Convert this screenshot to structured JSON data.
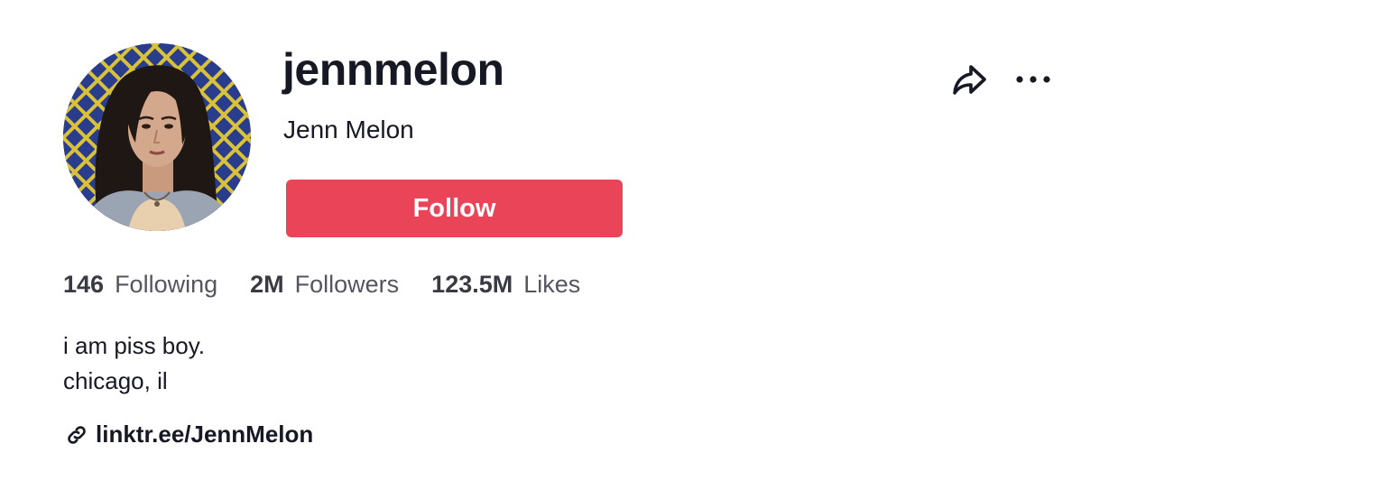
{
  "profile": {
    "username": "jennmelon",
    "display_name": "Jenn Melon",
    "avatar_icon": "user-avatar-photo"
  },
  "actions": {
    "follow_label": "Follow",
    "share_icon": "share-arrow-icon",
    "more_icon": "more-dots-icon"
  },
  "stats": [
    {
      "value": "146",
      "label": "Following"
    },
    {
      "value": "2M",
      "label": "Followers"
    },
    {
      "value": "123.5M",
      "label": "Likes"
    }
  ],
  "bio": {
    "lines": [
      "i am piss boy.",
      "chicago, il"
    ]
  },
  "link": {
    "icon": "link-icon",
    "text": "linktr.ee/JennMelon"
  },
  "colors": {
    "follow_bg": "#ea4459",
    "text_primary": "#161823",
    "text_secondary": "#555560"
  }
}
